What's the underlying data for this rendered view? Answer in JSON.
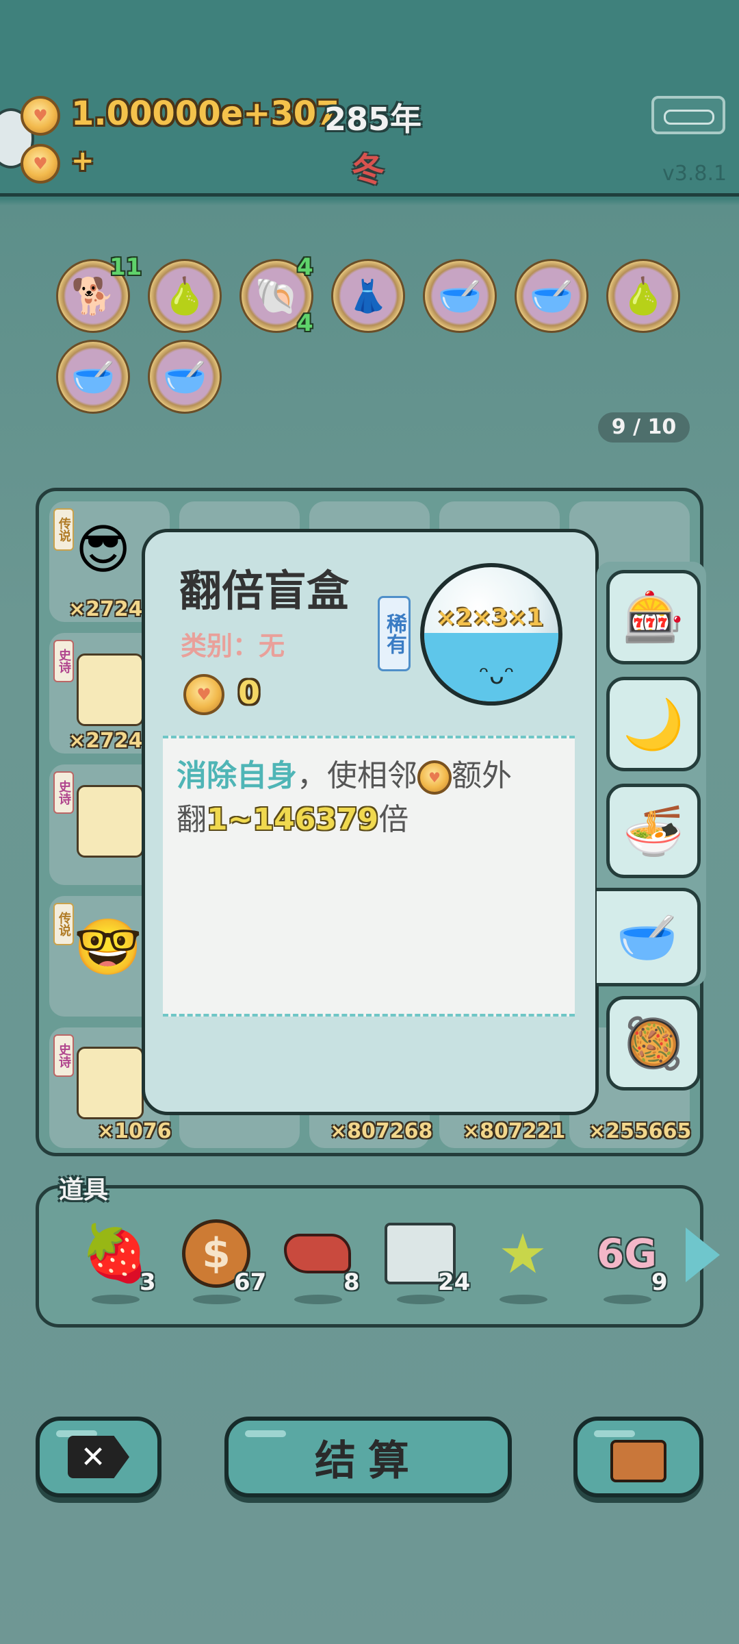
{
  "header": {
    "score": "1.00000e+307",
    "secondary": "+",
    "year": "285年",
    "season": "冬",
    "version": "v3.8.1"
  },
  "slots": {
    "badges": [
      "11",
      "4",
      "4"
    ],
    "icons": [
      "dog-icon",
      "pomelo-icon",
      "shell-icon",
      "skirt-icon",
      "bowl-arrow-icon",
      "bowl-arrow-icon",
      "pomelo-icon",
      "bowl-arrow-icon",
      "bowl-arrow-icon"
    ]
  },
  "page_counter": "9 / 10",
  "board": {
    "left_tags": [
      "传说",
      "史诗",
      "史诗",
      "传说",
      "史诗"
    ],
    "left_counts": [
      "×2724",
      "×2724",
      "",
      "",
      "×1076"
    ],
    "bottom_counts": [
      "×807268",
      "×807221",
      "×255665"
    ]
  },
  "popup": {
    "title": "翻倍盲盒",
    "rarity": "稀有",
    "category": "类别：无",
    "cost": "0",
    "desc_highlight": "消除自身",
    "desc_mid": "，使相邻",
    "desc_tail": "额外",
    "desc_line2_a": "翻",
    "desc_line2_num": "1~146379",
    "desc_line2_b": "倍",
    "bubble_text": "×2×3×1"
  },
  "props": {
    "title": "道具",
    "items": [
      {
        "icon": "lychee-icon",
        "count": "3"
      },
      {
        "icon": "dollar-coin-icon",
        "count": "67"
      },
      {
        "icon": "liver-icon",
        "count": "8"
      },
      {
        "icon": "ticket-icon",
        "count": "24"
      },
      {
        "icon": "star-icon",
        "count": ""
      },
      {
        "icon": "6g-icon",
        "label": "6G",
        "count": "9"
      }
    ]
  },
  "buttons": {
    "settle": "结算"
  },
  "colors": {
    "accent": "#3f817c",
    "gold": "#f4c24c",
    "highlight_teal": "#4fb5b6",
    "number_yellow": "#f0d94f"
  }
}
